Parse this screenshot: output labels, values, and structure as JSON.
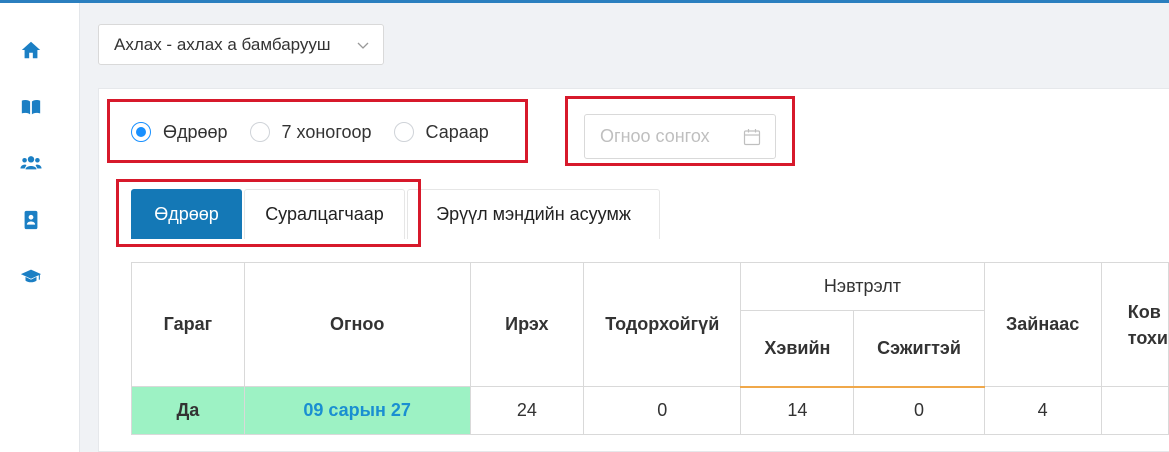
{
  "sidebar": {
    "items": [
      {
        "name": "home",
        "icon": "home-icon"
      },
      {
        "name": "book",
        "icon": "book-icon"
      },
      {
        "name": "users",
        "icon": "users-icon"
      },
      {
        "name": "contacts",
        "icon": "address-book-icon"
      },
      {
        "name": "graduation",
        "icon": "graduation-cap-icon"
      }
    ]
  },
  "group_select": {
    "value": "Ахлах - ахлах а бамбарууш"
  },
  "period_radios": [
    {
      "label": "Өдрөөр",
      "selected": true
    },
    {
      "label": "7 хоногоор",
      "selected": false
    },
    {
      "label": "Сараар",
      "selected": false
    }
  ],
  "date_picker": {
    "placeholder": "Огноо сонгох"
  },
  "tabs": [
    {
      "label": "Өдрөөр",
      "active": true
    },
    {
      "label": "Суралцагчаар",
      "active": false
    },
    {
      "label": "Эрүүл мэндийн асуумж",
      "active": false
    }
  ],
  "table": {
    "headers": {
      "day": "Гараг",
      "date": "Огноо",
      "arrived": "Ирэх",
      "unknown": "Тодорхойгүй",
      "attendance": "Нэвтрэлт",
      "normal": "Хэвийн",
      "suspicious": "Сэжигтэй",
      "good": "Зайнаас",
      "partial": "Ков\nтохи"
    },
    "rows": [
      {
        "day": "Да",
        "date": "09 сарын 27",
        "arrived": "24",
        "unknown": "0",
        "normal": "14",
        "suspicious": "0",
        "good": "4"
      }
    ]
  },
  "colors": {
    "accent": "#1478b6",
    "highlight_red": "#d7192b",
    "row_green": "#9df2c4"
  }
}
